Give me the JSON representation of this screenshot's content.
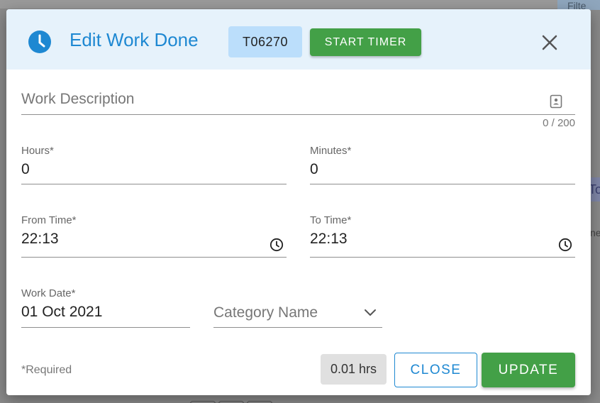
{
  "background": {
    "filter_label": "Filte",
    "side_tab_label": "To",
    "side_text": "ne"
  },
  "dialog": {
    "title": "Edit Work Done",
    "ticket_id": "T06270",
    "start_timer_label": "START TIMER",
    "work_description": {
      "placeholder": "Work Description",
      "value": "",
      "counter": "0 / 200"
    },
    "hours": {
      "label": "Hours*",
      "value": "0"
    },
    "minutes": {
      "label": "Minutes*",
      "value": "0"
    },
    "from_time": {
      "label": "From Time*",
      "value": "22:13"
    },
    "to_time": {
      "label": "To Time*",
      "value": "22:13"
    },
    "work_date": {
      "label": "Work Date*",
      "value": "01 Oct 2021"
    },
    "category": {
      "placeholder": "Category Name",
      "value": ""
    },
    "required_note": "*Required",
    "total_hours": "0.01 hrs",
    "close_label": "CLOSE",
    "update_label": "UPDATE"
  },
  "colors": {
    "accent_blue": "#1e88d2",
    "header_bg": "#e6f2fb",
    "chip_bg": "#bbdefb",
    "success_green": "#43a047"
  }
}
